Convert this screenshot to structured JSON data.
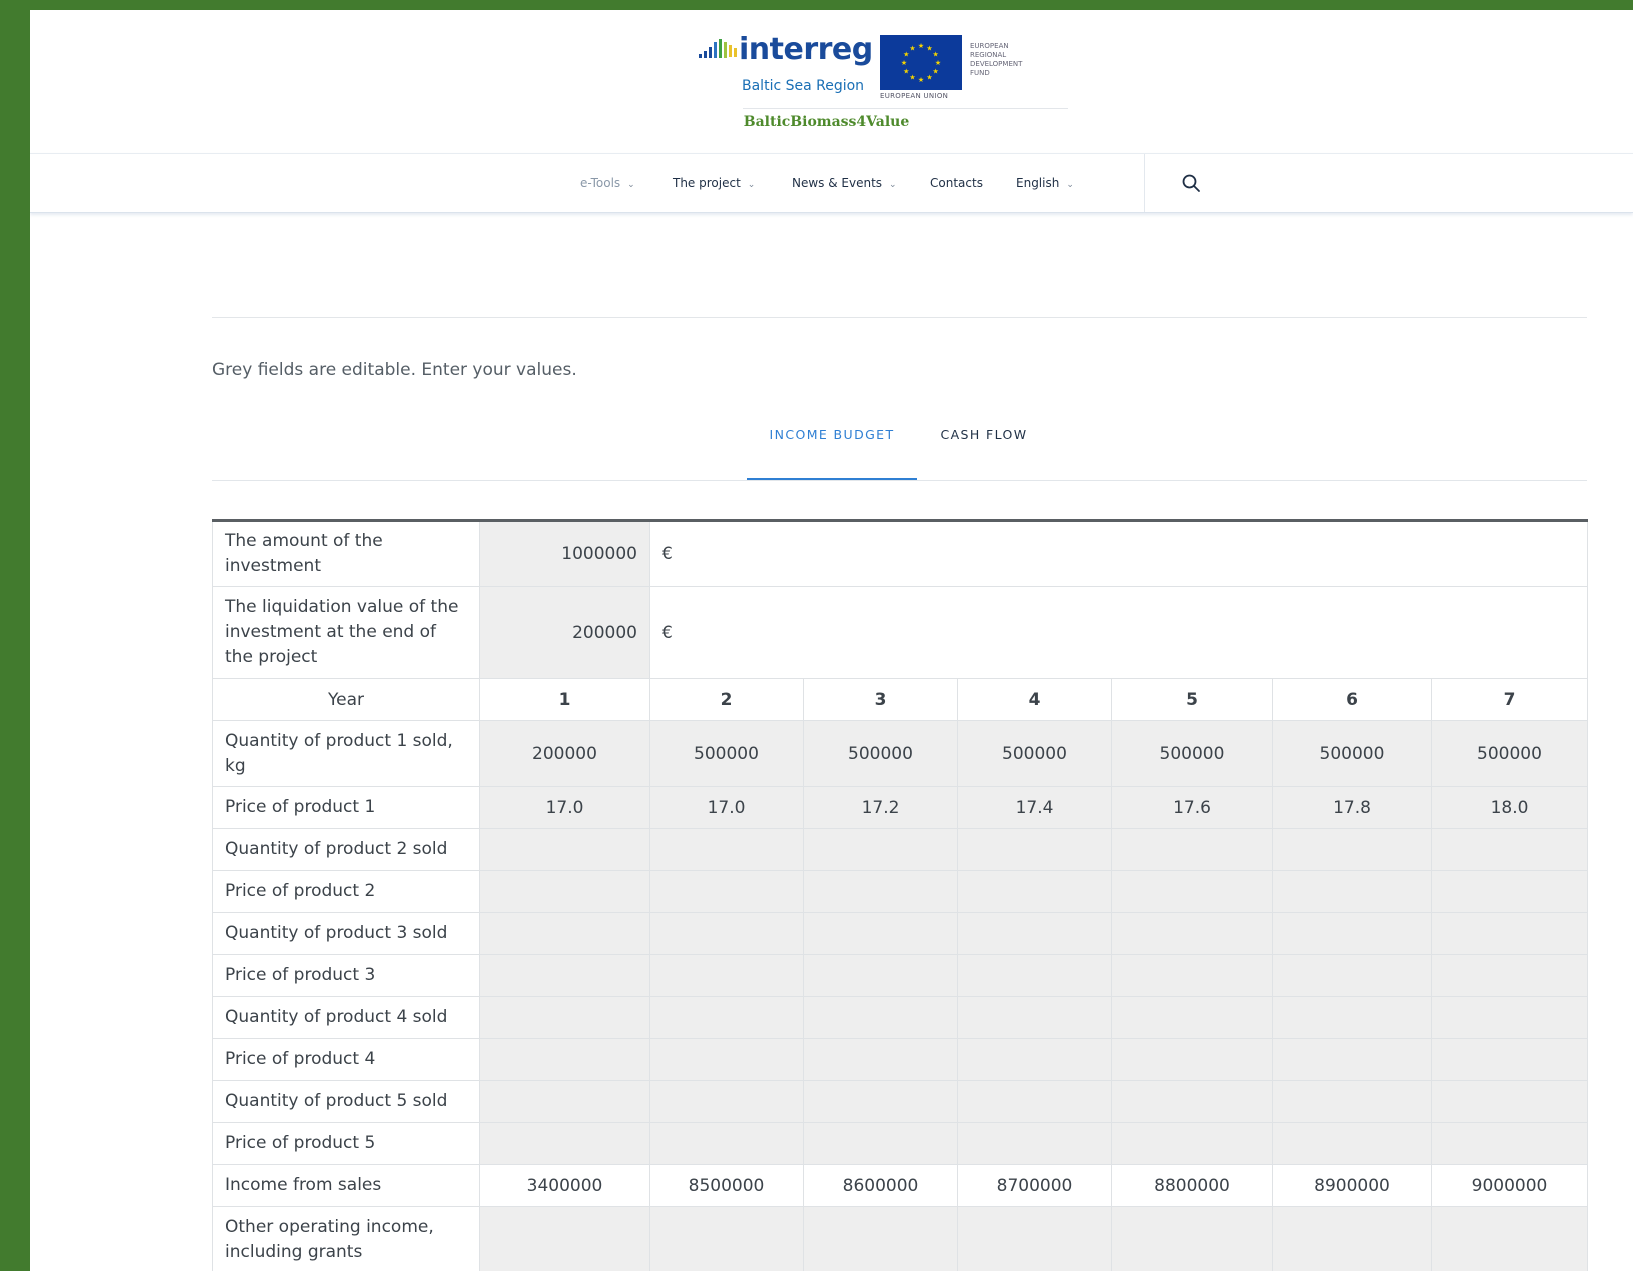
{
  "header": {
    "logo": {
      "brand_word": "interreg",
      "region": "Baltic Sea Region",
      "eu_caption": "EUROPEAN UNION",
      "fund_text": "EUROPEAN\nREGIONAL\nDEVELOPMENT\nFUND"
    },
    "project_name": "BalticBiomass4Value",
    "colors": {
      "brand_green": "#4e8a2c",
      "interreg_blue": "#1a4b9b",
      "eu_blue": "#0c3a9b",
      "active_tab_blue": "#2f7fd3",
      "frame_green": "#427b2e"
    }
  },
  "nav": {
    "items": [
      {
        "label": "e-Tools",
        "has_dropdown": true,
        "muted": true
      },
      {
        "label": "The project",
        "has_dropdown": true
      },
      {
        "label": "News & Events",
        "has_dropdown": true
      },
      {
        "label": "Contacts",
        "has_dropdown": false
      },
      {
        "label": "English",
        "has_dropdown": true
      }
    ],
    "search_icon": "search-icon",
    "chevron_icon": "chevron-down-icon"
  },
  "content": {
    "instructions": "Grey fields are editable. Enter your values.",
    "tabs": [
      {
        "label": "INCOME BUDGET",
        "active": true
      },
      {
        "label": "CASH FLOW",
        "active": false
      }
    ]
  },
  "table": {
    "investment": {
      "label": "The amount of the investment",
      "value": "1000000",
      "unit": "€"
    },
    "liquidation": {
      "label": "The liquidation value of the investment at the end of the project",
      "value": "200000",
      "unit": "€"
    },
    "year_label": "Year",
    "years": [
      "1",
      "2",
      "3",
      "4",
      "5",
      "6",
      "7"
    ],
    "rows": [
      {
        "label": "Quantity of product 1 sold, kg",
        "values": [
          "200000",
          "500000",
          "500000",
          "500000",
          "500000",
          "500000",
          "500000"
        ],
        "editable": true
      },
      {
        "label": "Price of product 1",
        "values": [
          "17.0",
          "17.0",
          "17.2",
          "17.4",
          "17.6",
          "17.8",
          "18.0"
        ],
        "editable": true
      },
      {
        "label": "Quantity of product 2 sold",
        "values": [
          "",
          "",
          "",
          "",
          "",
          "",
          ""
        ],
        "editable": true
      },
      {
        "label": "Price of product 2",
        "values": [
          "",
          "",
          "",
          "",
          "",
          "",
          ""
        ],
        "editable": true
      },
      {
        "label": "Quantity of product 3 sold",
        "values": [
          "",
          "",
          "",
          "",
          "",
          "",
          ""
        ],
        "editable": true
      },
      {
        "label": "Price of product 3",
        "values": [
          "",
          "",
          "",
          "",
          "",
          "",
          ""
        ],
        "editable": true
      },
      {
        "label": "Quantity of product 4 sold",
        "values": [
          "",
          "",
          "",
          "",
          "",
          "",
          ""
        ],
        "editable": true
      },
      {
        "label": "Price of product 4",
        "values": [
          "",
          "",
          "",
          "",
          "",
          "",
          ""
        ],
        "editable": true
      },
      {
        "label": "Quantity of product 5 sold",
        "values": [
          "",
          "",
          "",
          "",
          "",
          "",
          ""
        ],
        "editable": true
      },
      {
        "label": "Price of product 5",
        "values": [
          "",
          "",
          "",
          "",
          "",
          "",
          ""
        ],
        "editable": true
      },
      {
        "label": "Income from sales",
        "values": [
          "3400000",
          "8500000",
          "8600000",
          "8700000",
          "8800000",
          "8900000",
          "9000000"
        ],
        "editable": false
      },
      {
        "label": "Other operating income, including grants",
        "values": [
          "",
          "",
          "",
          "",
          "",
          "",
          ""
        ],
        "editable": true
      }
    ]
  }
}
